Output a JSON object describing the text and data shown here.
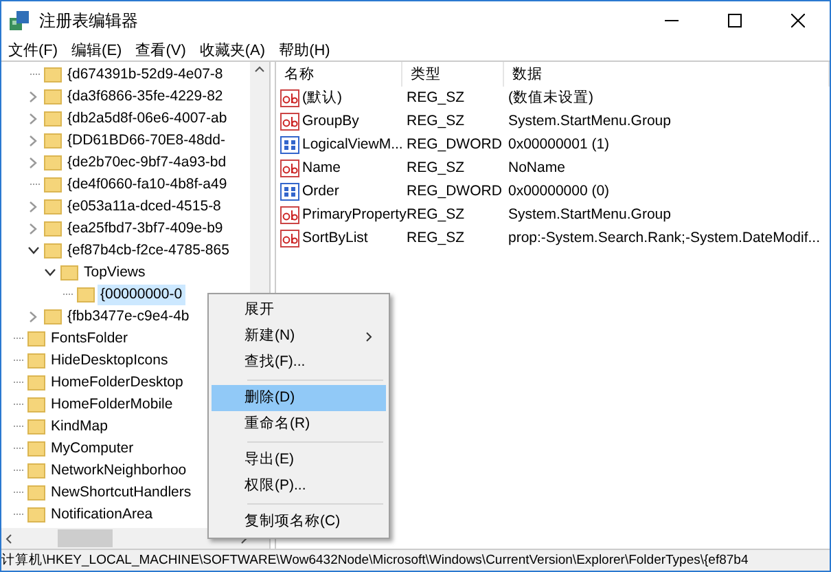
{
  "window": {
    "title": "注册表编辑器"
  },
  "menu": [
    "文件(F)",
    "编辑(E)",
    "查看(V)",
    "收藏夹(A)",
    "帮助(H)"
  ],
  "tree_continued": [
    {
      "label": "{d674391b-52d9-4e07-8",
      "selected": false
    },
    {
      "label": "{da3f6866-35fe-4229-82",
      "expanded": false,
      "selected": false
    },
    {
      "label": "{db2a5d8f-06e6-4007-ab",
      "expanded": false,
      "selected": false
    },
    {
      "label": "{DD61BD66-70E8-48dd-",
      "expanded": false,
      "selected": false
    },
    {
      "label": "{de2b70ec-9bf7-4a93-bd",
      "expanded": false,
      "selected": false
    },
    {
      "label": "{de4f0660-fa10-4b8f-a49",
      "selected": false
    },
    {
      "label": "{e053a11a-dced-4515-8",
      "expanded": false,
      "selected": false
    },
    {
      "label": "{ea25fbd7-3bf7-409e-b9",
      "expanded": false,
      "selected": false
    },
    {
      "label": "{ef87b4cb-f2ce-4785-865",
      "expanded": true,
      "selected": false,
      "children": [
        {
          "label": "TopViews",
          "expanded": true,
          "selected": false,
          "children": [
            {
              "label": "{00000000-0",
              "selected": true
            }
          ]
        }
      ]
    },
    {
      "label": "{fbb3477e-c9e4-4b",
      "expanded": false,
      "selected": false
    }
  ],
  "tree": [
    {
      "label": "FontsFolder",
      "selected": false
    },
    {
      "label": "HideDesktopIcons",
      "selected": false
    },
    {
      "label": "HomeFolderDesktop",
      "selected": false
    },
    {
      "label": "HomeFolderMobile",
      "selected": false
    },
    {
      "label": "KindMap",
      "selected": false
    },
    {
      "label": "MyComputer",
      "selected": false
    },
    {
      "label": "NetworkNeighborhoo",
      "selected": false
    },
    {
      "label": "NewShortcutHandlers",
      "selected": false
    },
    {
      "label": "NotificationArea",
      "selected": false
    }
  ],
  "table": {
    "columns": [
      "名称",
      "类型",
      "数据"
    ],
    "rows": [
      {
        "kind": "string",
        "name": "(默认)",
        "type": "REG_SZ",
        "data": "(数值未设置)"
      },
      {
        "kind": "string",
        "name": "GroupBy",
        "type": "REG_SZ",
        "data": "System.StartMenu.Group"
      },
      {
        "kind": "binary",
        "name": "LogicalViewM...",
        "type": "REG_DWORD",
        "data": "0x00000001 (1)"
      },
      {
        "kind": "string",
        "name": "Name",
        "type": "REG_SZ",
        "data": "NoName"
      },
      {
        "kind": "binary",
        "name": "Order",
        "type": "REG_DWORD",
        "data": "0x00000000 (0)"
      },
      {
        "kind": "string",
        "name": "PrimaryProperty",
        "type": "REG_SZ",
        "data": "System.StartMenu.Group"
      },
      {
        "kind": "string",
        "name": "SortByList",
        "type": "REG_SZ",
        "data": "prop:-System.Search.Rank;-System.DateModif..."
      }
    ]
  },
  "context_menu": [
    {
      "kind": "item",
      "label": "展开",
      "selected": false
    },
    {
      "kind": "submenu",
      "label": "新建(N)",
      "selected": false
    },
    {
      "kind": "item",
      "label": "查找(F)...",
      "selected": false
    },
    {
      "kind": "separator"
    },
    {
      "kind": "item",
      "label": "删除(D)",
      "selected": true
    },
    {
      "kind": "item",
      "label": "重命名(R)",
      "selected": false
    },
    {
      "kind": "separator"
    },
    {
      "kind": "item",
      "label": "导出(E)",
      "selected": false
    },
    {
      "kind": "item",
      "label": "权限(P)...",
      "selected": false
    },
    {
      "kind": "separator"
    },
    {
      "kind": "item",
      "label": "复制项名称(C)",
      "selected": false
    }
  ],
  "status_bar": "计算机\\HKEY_LOCAL_MACHINE\\SOFTWARE\\Wow6432Node\\Microsoft\\Windows\\CurrentVersion\\Explorer\\FolderTypes\\{ef87b4"
}
